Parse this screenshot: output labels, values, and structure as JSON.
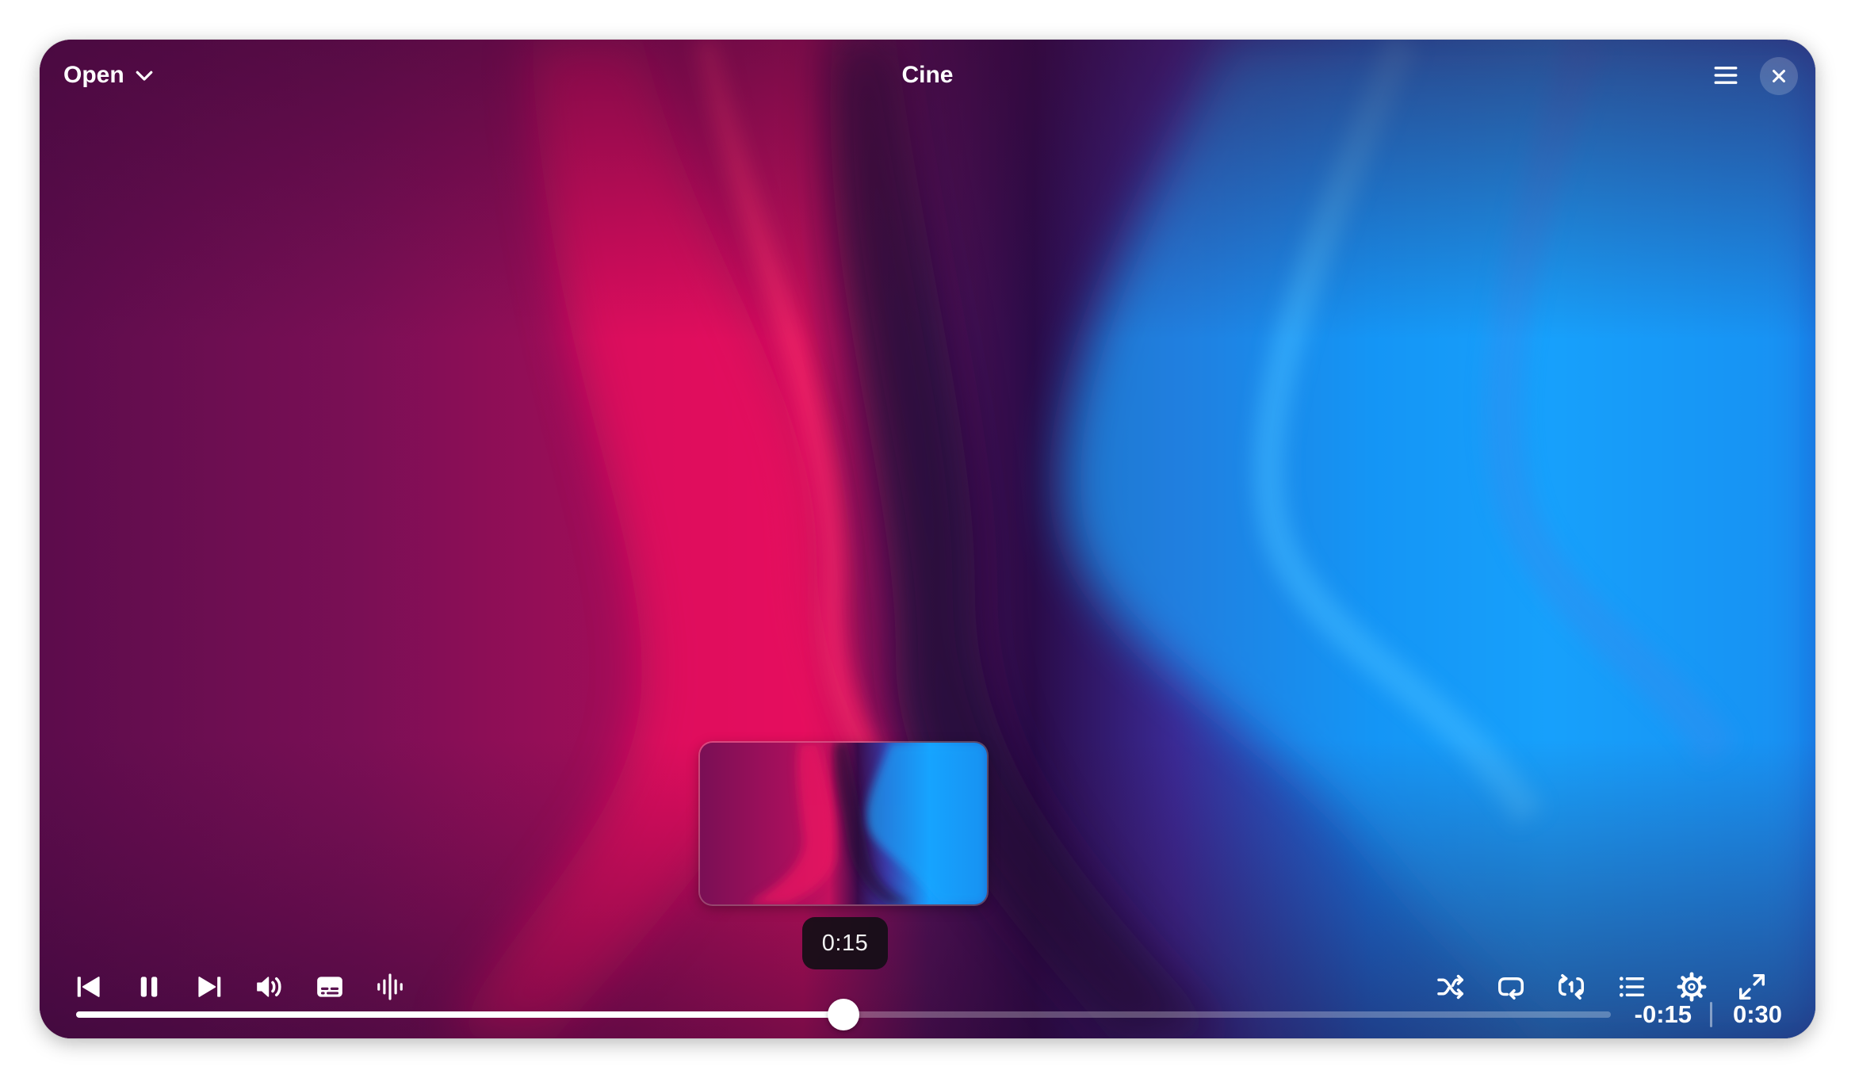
{
  "header": {
    "open_label": "Open",
    "title": "Cine"
  },
  "preview": {
    "time": "0:15"
  },
  "playback": {
    "progress": 0.5,
    "remaining": "-0:15",
    "total": "0:30"
  },
  "controls": {
    "left": [
      "skip-back-icon",
      "pause-icon",
      "skip-forward-icon",
      "volume-icon",
      "subtitles-icon",
      "audio-track-icon"
    ],
    "right": [
      "shuffle-icon",
      "repeat-icon",
      "repeat-one-icon",
      "playlist-icon",
      "settings-gear-icon",
      "fullscreen-icon"
    ]
  },
  "colors": {
    "magenta": "#e0105e",
    "purple": "#4a0d45",
    "blue": "#1a9cf5"
  }
}
